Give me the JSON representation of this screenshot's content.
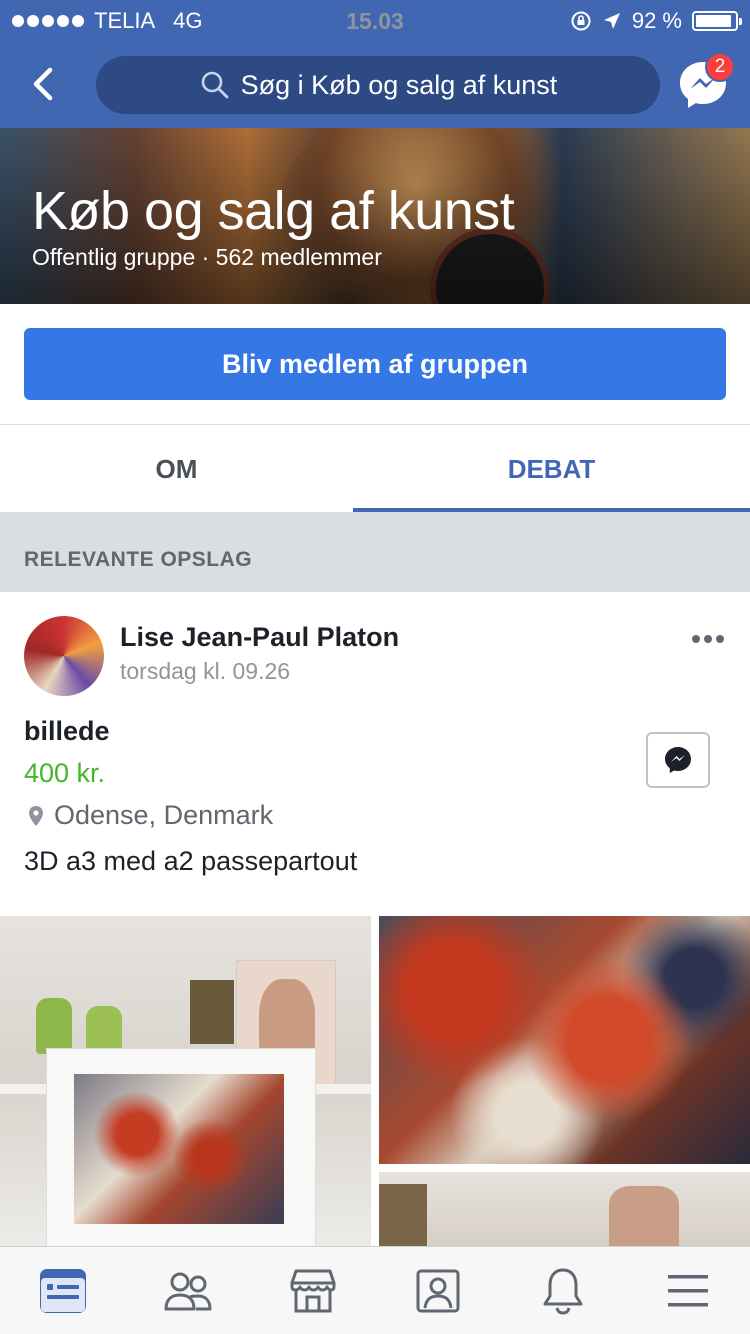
{
  "status_bar": {
    "carrier": "TELIA",
    "network": "4G",
    "time": "15.03",
    "battery": "92 %",
    "battery_level": 0.92
  },
  "nav_bar": {
    "search_text": "Søg i Køb og salg af kunst",
    "messenger_badge": "2"
  },
  "group": {
    "name": "Køb og salg af kunst",
    "meta": "Offentlig gruppe · 562 medlemmer",
    "join_label": "Bliv medlem af gruppen"
  },
  "tabs": [
    {
      "label": "OM",
      "active": false
    },
    {
      "label": "DEBAT",
      "active": true
    }
  ],
  "section_header": "RELEVANTE OPSLAG",
  "post": {
    "author": "Lise Jean-Paul Platon",
    "time": "torsdag kl. 09.26",
    "item_title": "billede",
    "price": "400 kr.",
    "location": "Odense, Denmark",
    "description": "3D a3 med a2 passepartout"
  },
  "bottom_nav": [
    "news-feed-icon",
    "groups-icon",
    "marketplace-icon",
    "profile-icon",
    "notifications-icon",
    "menu-icon"
  ],
  "colors": {
    "brand": "#4267b2",
    "button": "#3578e5",
    "price": "#42b72a",
    "badge": "#fa3e3e"
  }
}
